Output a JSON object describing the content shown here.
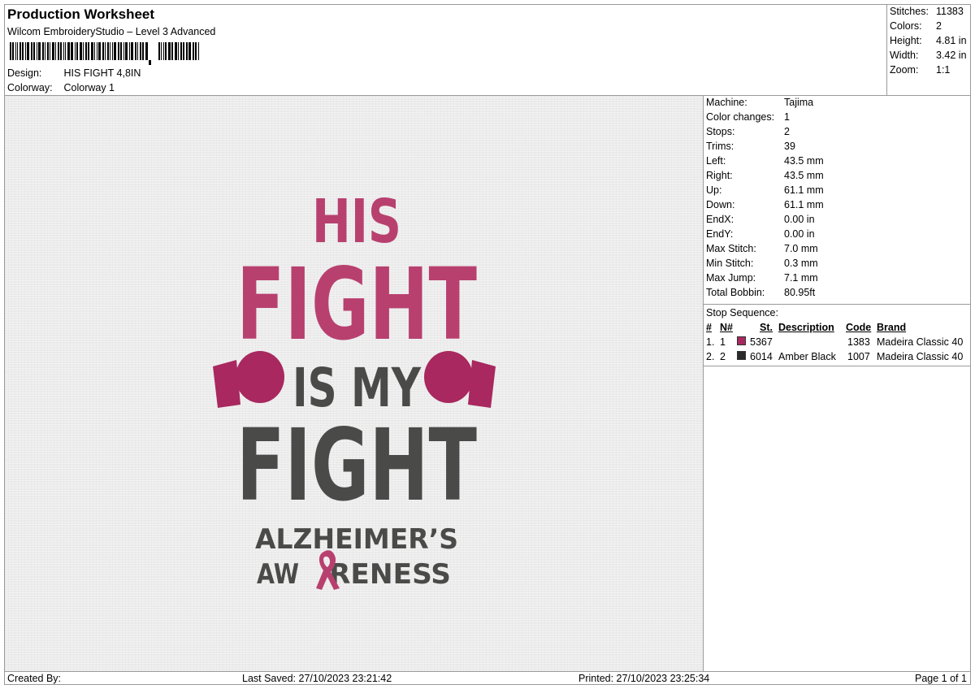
{
  "header": {
    "title": "Production Worksheet",
    "software": "Wilcom EmbroideryStudio – Level 3 Advanced",
    "design_label": "Design:",
    "design_value": "HIS FIGHT 4,8IN",
    "colorway_label": "Colorway:",
    "colorway_value": "Colorway 1"
  },
  "stats": [
    {
      "label": "Stitches:",
      "value": "11383"
    },
    {
      "label": "Colors:",
      "value": "2"
    },
    {
      "label": "Height:",
      "value": "4.81 in"
    },
    {
      "label": "Width:",
      "value": "3.42 in"
    },
    {
      "label": "Zoom:",
      "value": "1:1"
    }
  ],
  "properties": [
    {
      "label": "Machine:",
      "value": "Tajima"
    },
    {
      "label": "Color changes:",
      "value": "1"
    },
    {
      "label": "Stops:",
      "value": "2"
    },
    {
      "label": "Trims:",
      "value": "39"
    },
    {
      "label": "Left:",
      "value": "43.5 mm"
    },
    {
      "label": "Right:",
      "value": "43.5 mm"
    },
    {
      "label": "Up:",
      "value": "61.1 mm"
    },
    {
      "label": "Down:",
      "value": "61.1 mm"
    },
    {
      "label": "EndX:",
      "value": "0.00 in"
    },
    {
      "label": "EndY:",
      "value": "0.00 in"
    },
    {
      "label": "Max Stitch:",
      "value": "7.0 mm"
    },
    {
      "label": "Min Stitch:",
      "value": "0.3 mm"
    },
    {
      "label": "Max Jump:",
      "value": "7.1 mm"
    },
    {
      "label": "Total Bobbin:",
      "value": "80.95ft"
    }
  ],
  "stop_sequence": {
    "label": "Stop Sequence:",
    "columns": [
      "#",
      "N#",
      "St.",
      "Description",
      "Code",
      "Brand"
    ],
    "rows": [
      {
        "num": "1.",
        "n": "1",
        "color": "#a8285f",
        "st": "5367",
        "desc": "",
        "code": "1383",
        "brand": "Madeira Classic 40"
      },
      {
        "num": "2.",
        "n": "2",
        "color": "#2a2a2a",
        "st": "6014",
        "desc": "Amber Black",
        "code": "1007",
        "brand": "Madeira Classic 40"
      }
    ]
  },
  "design": {
    "line1": "HIS",
    "line2": "FIGHT",
    "line3": "IS MY",
    "line4": "FIGHT",
    "line5": "ALZHEIMER’S",
    "line6a": "AW",
    "line6b": "RENESS",
    "pink": "#b8406f",
    "dark": "#4a4b48",
    "glove": "#a8285f",
    "ribbon": "#b8406f"
  },
  "footer": {
    "created_by": "Created By:",
    "last_saved": "Last Saved: 27/10/2023 23:21:42",
    "printed": "Printed: 27/10/2023 23:25:34",
    "page": "Page 1 of 1"
  }
}
